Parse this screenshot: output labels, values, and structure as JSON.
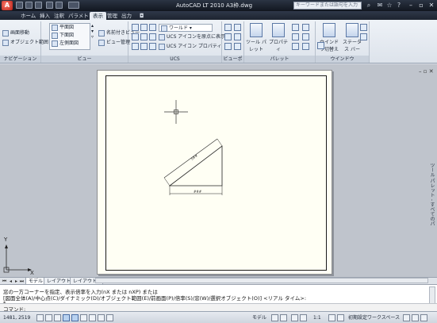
{
  "window": {
    "title": "AutoCAD LT 2010   A3枠.dwg",
    "search_placeholder": "キーワードまたは語句を入力"
  },
  "tabs": [
    "ホーム",
    "挿入",
    "注釈",
    "パラメトリック",
    "表示",
    "管理",
    "出力"
  ],
  "active_tab_index": 4,
  "ribbon": {
    "nav_panel": {
      "label": "ナビゲーション",
      "items": [
        "画面移動",
        "オブジェクト範囲"
      ]
    },
    "view_panel": {
      "label": "ビュー",
      "views": [
        "平面図",
        "下面図",
        "左側面図"
      ],
      "items": [
        "名前付きビュー",
        "ビュー管理"
      ]
    },
    "ucs_panel": {
      "label": "UCS",
      "items": [
        "ワールド",
        "UCS アイコンを原点に表示",
        "UCS アイコン プロパティ"
      ]
    },
    "viewports_panel": {
      "label": "ビューポー..."
    },
    "palettes_panel": {
      "label": "パレット",
      "items": [
        "ツール パレット",
        "プロパティ"
      ]
    },
    "window_panel": {
      "label": "ウインドウ",
      "items": [
        "ウインドウ切替え",
        "ステータス バー"
      ]
    }
  },
  "drawing": {
    "dim_slope": "5##",
    "dim_base": "###",
    "ucs_y": "Y",
    "ucs_x": "X"
  },
  "side_palette": "ツール パレット - すべてのパ",
  "layout_tabs": [
    "モデル",
    "レイアウト1",
    "レイアウト2"
  ],
  "active_layout_index": 0,
  "command": {
    "history": [
      "窓の一方コーナーを指定、表示倍率を入力(nX または nXP) または",
      "[図面全体(A)/中心点(C)/ダイナミック(D)/オブジェクト範囲(E)/前画面(P)/倍率(S)/窓(W)/選択オブジェクト(O)] <リアル タイム>:",
      "*"
    ],
    "prompt": "コマンド:"
  },
  "status": {
    "coords": "1481, 2519",
    "right_items": [
      "モデル",
      "1:1",
      "初期設定ワークスペース"
    ]
  }
}
